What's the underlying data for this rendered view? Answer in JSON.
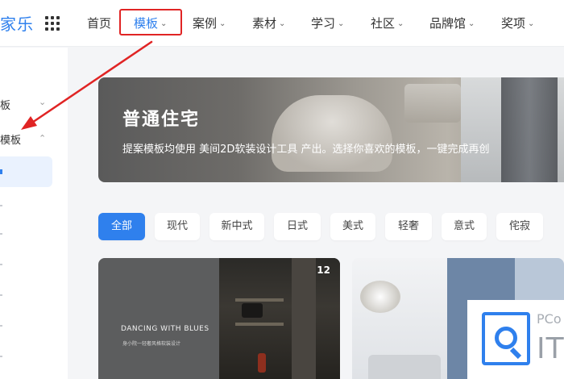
{
  "app": {
    "logo_text": "家乐"
  },
  "nav": {
    "items": [
      {
        "label": "首页",
        "caret": ""
      },
      {
        "label": "模板",
        "caret": "⌄"
      },
      {
        "label": "案例",
        "caret": "⌄"
      },
      {
        "label": "素材",
        "caret": "⌄"
      },
      {
        "label": "学习",
        "caret": "⌄"
      },
      {
        "label": "社区",
        "caret": "⌄"
      },
      {
        "label": "品牌馆",
        "caret": "⌄"
      },
      {
        "label": "奖项",
        "caret": "⌄"
      }
    ],
    "active_index": 1
  },
  "sidebar": {
    "items": [
      {
        "label": "板",
        "expanded": false
      },
      {
        "label": "模板",
        "expanded": true
      }
    ]
  },
  "banner": {
    "title": "普通住宅",
    "subtitle": "提案模板均使用    美间2D软装设计工具    产出。选择你喜欢的模板，一键完成再创"
  },
  "filters": {
    "chips": [
      "全部",
      "现代",
      "新中式",
      "日式",
      "美式",
      "轻奢",
      "意式",
      "侘寂"
    ],
    "active_index": 0
  },
  "cards": [
    {
      "title": "DANCING WITH BLUES",
      "subtitle": "身小院一轻奢风格软装设计",
      "badge": "12"
    },
    {
      "title": "",
      "subtitle": "",
      "badge": ""
    }
  ],
  "watermark": {
    "top_text": "PCo",
    "big_text": "IT"
  },
  "colors": {
    "accent": "#2f80ed",
    "annotation": "#e02424"
  },
  "icons": {
    "apps": "grid-icon",
    "annotation": "red-arrow"
  }
}
